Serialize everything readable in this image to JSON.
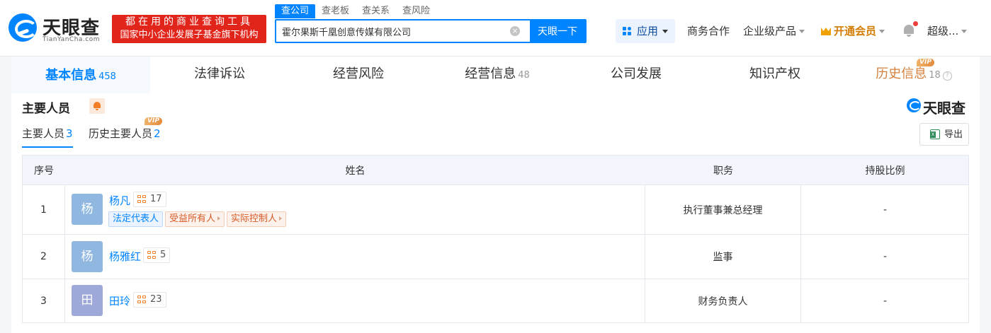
{
  "header": {
    "logo_cn": "天眼查",
    "logo_en": "TianYanCha.com",
    "slogan_line1": "都在用的商业查询工具",
    "slogan_line2": "国家中小企业发展子基金旗下机构",
    "search_tabs": [
      "查公司",
      "查老板",
      "查关系",
      "查风险"
    ],
    "search_value": "霍尔果斯千凰创意传媒有限公司",
    "clear_glyph": "×",
    "search_button": "天眼一下",
    "apps_label": "应用",
    "nav_business": "商务合作",
    "nav_enterprise": "企业级产品",
    "nav_vip": "开通会员",
    "nav_user": "超级..."
  },
  "main_tabs": [
    {
      "label": "基本信息",
      "count": "458"
    },
    {
      "label": "法律诉讼",
      "count": ""
    },
    {
      "label": "经营风险",
      "count": ""
    },
    {
      "label": "经营信息",
      "count": "48"
    },
    {
      "label": "公司发展",
      "count": ""
    },
    {
      "label": "知识产权",
      "count": ""
    },
    {
      "label": "历史信息",
      "count": "18",
      "badge": "VIP"
    }
  ],
  "section": {
    "title": "主要人员",
    "brand": "天眼查",
    "sub_tabs": [
      {
        "label": "主要人员",
        "count": "3"
      },
      {
        "label": "历史主要人员",
        "count": "2",
        "badge": "VIP"
      }
    ],
    "export_label": "导出",
    "help_glyph": "?"
  },
  "table": {
    "headers": [
      "序号",
      "姓名",
      "职务",
      "持股比例"
    ],
    "rows": [
      {
        "index": "1",
        "avatar": "杨",
        "avatar_color": "#8fb7e0",
        "name": "杨凡",
        "relations": "17",
        "tags": [
          {
            "label": "法定代表人",
            "style": "blue"
          },
          {
            "label": "受益所有人",
            "style": "orange"
          },
          {
            "label": "实际控制人",
            "style": "orange"
          }
        ],
        "position": "执行董事兼总经理",
        "share": "-"
      },
      {
        "index": "2",
        "avatar": "杨",
        "avatar_color": "#8fb7e0",
        "name": "杨雅红",
        "relations": "5",
        "tags": [],
        "position": "监事",
        "share": "-"
      },
      {
        "index": "3",
        "avatar": "田",
        "avatar_color": "#9ea9d9",
        "name": "田玲",
        "relations": "23",
        "tags": [],
        "position": "财务负责人",
        "share": "-"
      }
    ]
  },
  "colors": {
    "primary": "#0084ff",
    "slogan_red": "#e1251b",
    "vip_orange": "#d27c00",
    "history_orange": "#d4813e"
  }
}
